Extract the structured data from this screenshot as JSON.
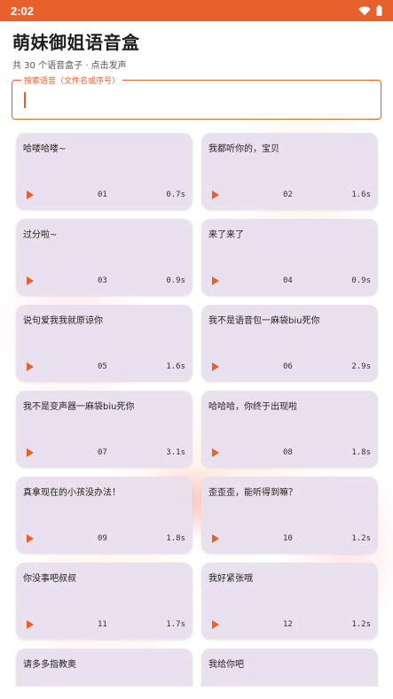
{
  "status": {
    "time": "2:02"
  },
  "app": {
    "title": "萌妹御姐语音盒",
    "subtitle": "共 30 个语音盒子 · 点击发声"
  },
  "search": {
    "label": "搜索语音（文件名或序号）",
    "value": ""
  },
  "colors": {
    "accent": "#e8602c",
    "card_bg": "#e8e0ec"
  },
  "cards": [
    {
      "name": "哈喽哈喽~",
      "num": "01",
      "dur": "0.7s"
    },
    {
      "name": "我都听你的，宝贝",
      "num": "02",
      "dur": "1.6s"
    },
    {
      "name": "过分啦~",
      "num": "03",
      "dur": "0.9s"
    },
    {
      "name": "来了来了",
      "num": "04",
      "dur": "0.9s"
    },
    {
      "name": "说句爱我我就原谅你",
      "num": "05",
      "dur": "1.6s"
    },
    {
      "name": "我不是语音包一麻袋biu死你",
      "num": "06",
      "dur": "2.9s"
    },
    {
      "name": "我不是变声器一麻袋biu死你",
      "num": "07",
      "dur": "3.1s"
    },
    {
      "name": "哈哈哈，你终于出现啦",
      "num": "08",
      "dur": "1.8s"
    },
    {
      "name": "真拿现在的小孩没办法！",
      "num": "09",
      "dur": "1.8s"
    },
    {
      "name": "歪歪歪，能听得到嘛？",
      "num": "10",
      "dur": "1.2s"
    },
    {
      "name": "你没事吧叔叔",
      "num": "11",
      "dur": "1.7s"
    },
    {
      "name": "我好紧张哦",
      "num": "12",
      "dur": "1.2s"
    },
    {
      "name": "请多多指教奥",
      "num": "",
      "dur": ""
    },
    {
      "name": "我给你吧",
      "num": "",
      "dur": ""
    }
  ]
}
